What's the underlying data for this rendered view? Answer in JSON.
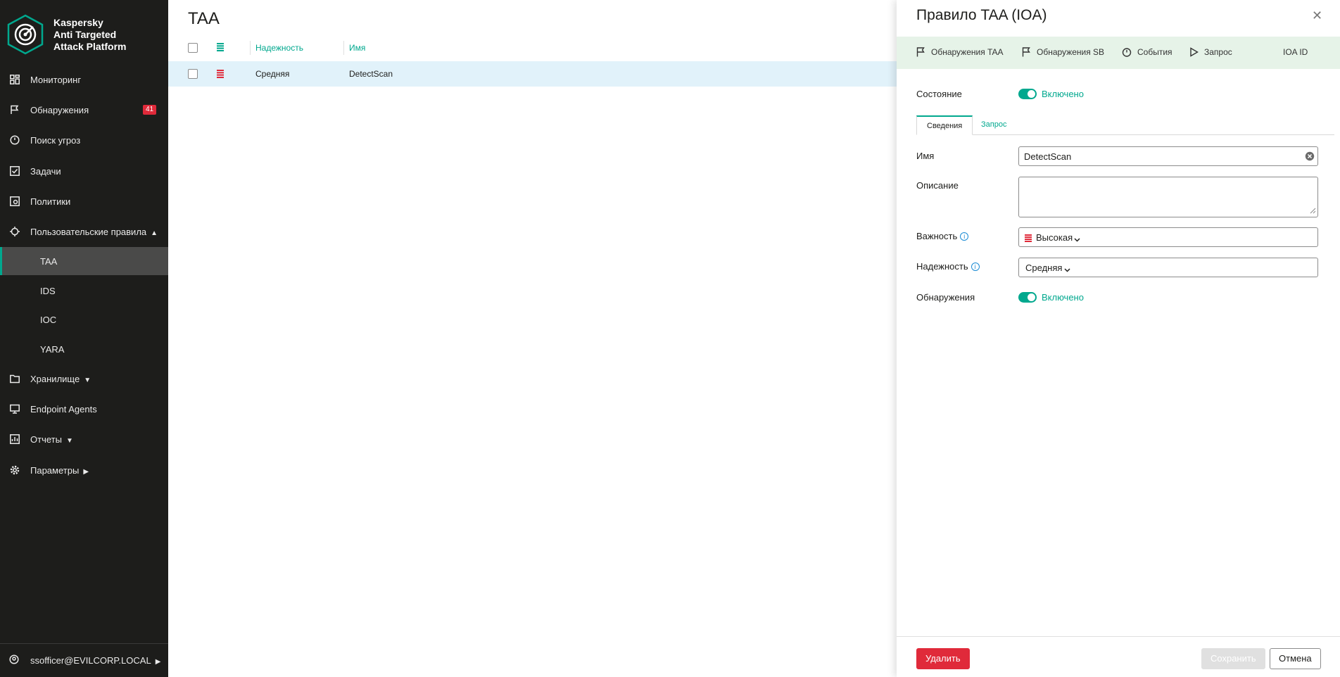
{
  "brand": {
    "line1": "Kaspersky",
    "line2": "Anti Targeted",
    "line3": "Attack Platform"
  },
  "sidebar": {
    "items": [
      {
        "label": "Мониторинг",
        "icon": "dashboard-icon"
      },
      {
        "label": "Обнаружения",
        "icon": "flag-icon",
        "badge": "41"
      },
      {
        "label": "Поиск угроз",
        "icon": "threat-hunting-icon"
      },
      {
        "label": "Задачи",
        "icon": "task-checkbox-icon"
      },
      {
        "label": "Политики",
        "icon": "policy-icon"
      },
      {
        "label": "Пользовательские правила",
        "icon": "crosshair-icon"
      },
      {
        "label": "TAA",
        "sub": true,
        "active": true
      },
      {
        "label": "IDS",
        "sub": true
      },
      {
        "label": "IOC",
        "sub": true
      },
      {
        "label": "YARA",
        "sub": true
      },
      {
        "label": "Хранилище",
        "icon": "folder-icon"
      },
      {
        "label": "Endpoint Agents",
        "icon": "monitor-icon"
      },
      {
        "label": "Отчеты",
        "icon": "report-icon"
      },
      {
        "label": "Параметры",
        "icon": "gear-icon"
      }
    ],
    "user": "ssofficer@EVILCORP.LOCAL"
  },
  "main": {
    "title": "TAA",
    "columns": {
      "reliability": "Надежность",
      "name": "Имя"
    },
    "rows": [
      {
        "reliability": "Средняя",
        "name": "DetectScan",
        "importance_color": "#e02a3a"
      }
    ]
  },
  "drawer": {
    "title": "Правило TAA (IOA)",
    "actions": {
      "taa": "Обнаружения TAA",
      "sb": "Обнаружения SB",
      "events": "События",
      "query": "Запрос",
      "ioa_id": "IOA ID"
    },
    "state_label": "Состояние",
    "state_value": "Включено",
    "tabs": {
      "details": "Сведения",
      "query": "Запрос"
    },
    "fields": {
      "name_label": "Имя",
      "name_value": "DetectScan",
      "description_label": "Описание",
      "description_value": "",
      "importance_label": "Важность",
      "importance_value": "Высокая",
      "reliability_label": "Надежность",
      "reliability_value": "Средняя",
      "detections_label": "Обнаружения",
      "detections_value": "Включено"
    },
    "buttons": {
      "delete": "Удалить",
      "save": "Сохранить",
      "cancel": "Отмена"
    }
  },
  "colors": {
    "accent": "#00a88e",
    "danger": "#e02a3a",
    "sidebar_bg": "#1d1d1b",
    "row_highlight": "#e1f2fa",
    "actionbar_bg": "#e6f3e8"
  }
}
